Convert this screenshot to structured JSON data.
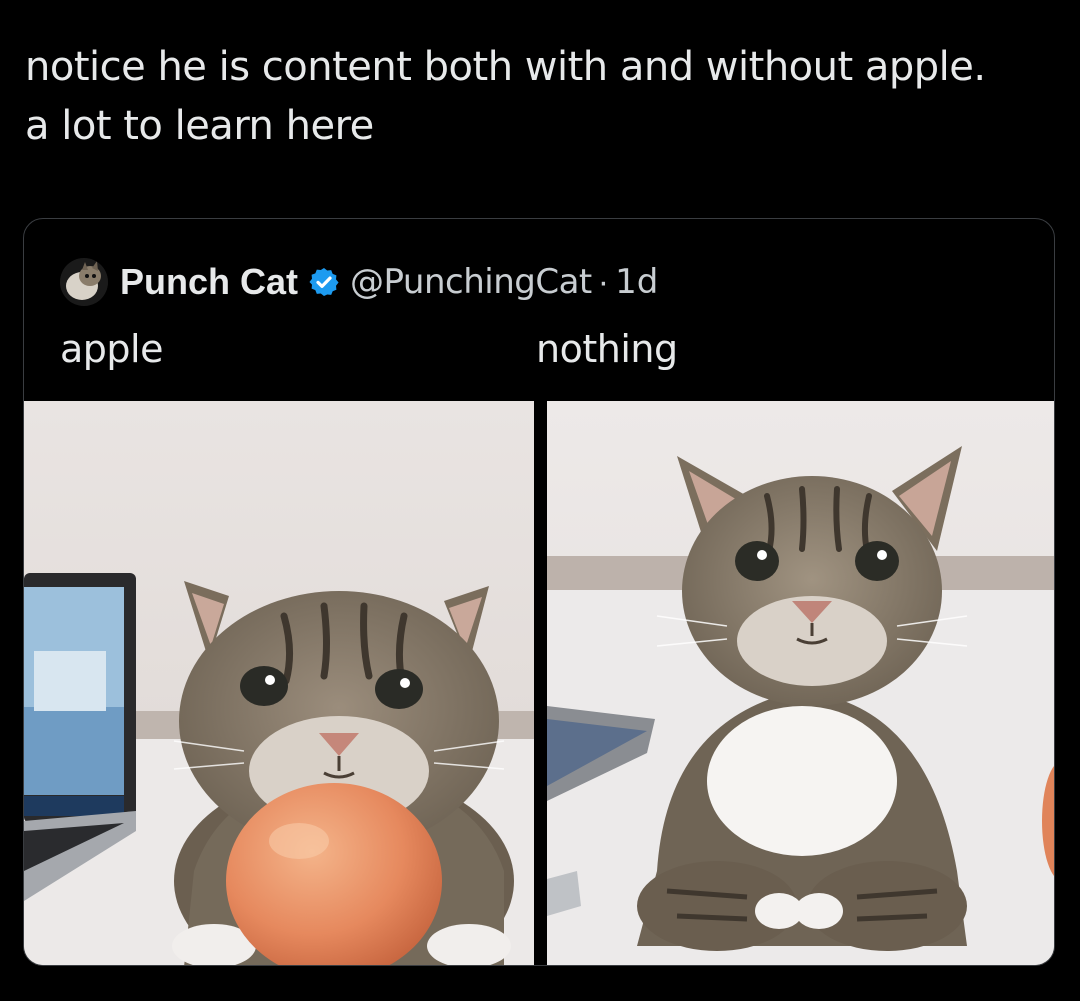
{
  "post": {
    "text_line1": "notice he is content both with and without apple.",
    "text_line2": "a lot to learn here"
  },
  "quote": {
    "display_name": "Punch Cat",
    "handle": "@PunchingCat",
    "separator": "·",
    "time": "1d",
    "verified_icon": "verified-badge-icon",
    "caption_left": "apple",
    "caption_right": "nothing"
  },
  "colors": {
    "background": "#000000",
    "text": "#e7e9ea",
    "verified": "#1d9bf0"
  }
}
